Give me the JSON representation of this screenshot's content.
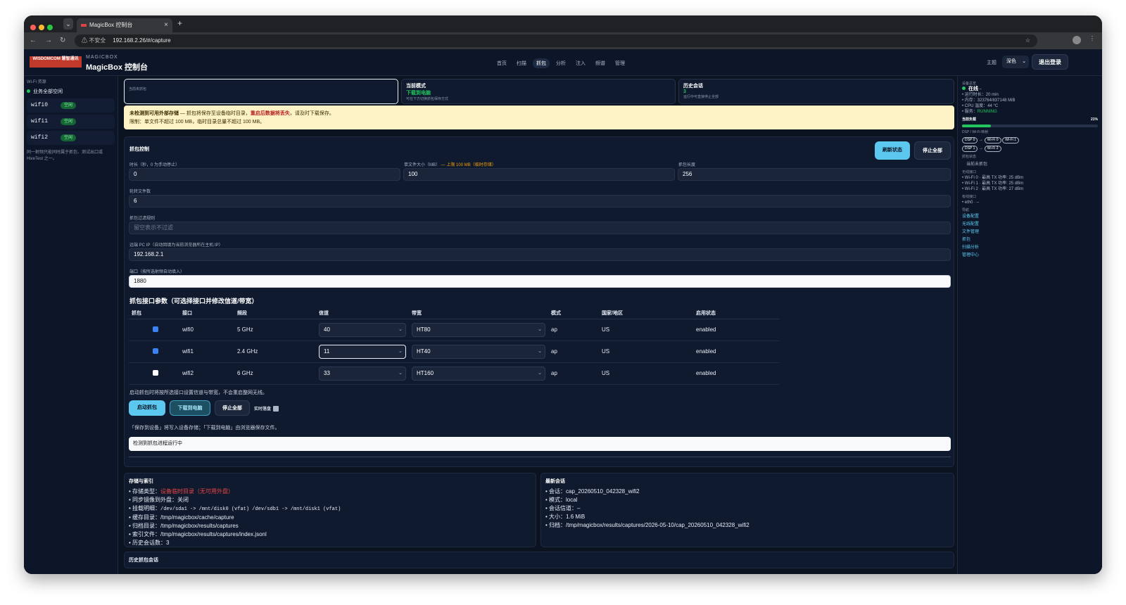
{
  "browser": {
    "tab_title": "MagicBox 控制台",
    "url": "192.168.2.26/#/capture",
    "security": "⚠ 不安全"
  },
  "topbar": {
    "logo_text": "WISDOMCOM 慧智通讯",
    "brand_small": "MAGICBOX",
    "brand_title": "MagicBox 控制台",
    "nav": [
      "首页",
      "扫描",
      "抓包",
      "分析",
      "注入",
      "频谱",
      "管理"
    ],
    "nav_active": "抓包",
    "theme_label": "主题",
    "theme_value": "深色",
    "logout_label": "退出登录"
  },
  "left": {
    "section_title": "Wi-Fi 资源",
    "status_line": "业务全部空闲",
    "items": [
      {
        "name": "wifi0",
        "badge": "空闲"
      },
      {
        "name": "wifi1",
        "badge": "空闲"
      },
      {
        "name": "wifi2",
        "badge": "空闲"
      }
    ],
    "note": "同一射频只能同时属于抓包、测试出口或 HiveTest 之一。"
  },
  "status_cards": {
    "c1_text": "当前未抓包",
    "c2_title": "当前模式",
    "c2_value": "下载到电脑",
    "c2_sub": "可在下方切换抓包保存方式",
    "c3_title": "历史会话",
    "c3_value": "3",
    "c3_sub": "运行中可直接停止全部"
  },
  "banner": {
    "bold_text": "未检测到可用外部存储",
    "text1": " — 抓包将保存至设备临时目录，",
    "red_text": "重启后数据将丢失",
    "text2": "，请及时下载保存。",
    "line2": "限制：单文件不超过 100 MB，临时目录总量不超过 100 MB。"
  },
  "capture": {
    "title": "抓包控制",
    "refresh_label": "刷新状态",
    "stop_all_label": "停止全部",
    "duration_label": "时长（秒，0 为手动停止）",
    "duration_value": "0",
    "filesize_label": "单文件大小（MB）",
    "filesize_hint": " — 上限 100 MB（临时存储）",
    "filesize_value": "100",
    "snaplen_label": "抓包长度",
    "snaplen_value": "256",
    "rotate_label": "轮转文件数",
    "rotate_value": "6",
    "filter_label": "抓包过滤规则",
    "filter_placeholder": "留空表示不过滤",
    "remote_ip_label": "远端 PC IP（自动回填为当前浏览器所在主机 IP）",
    "remote_ip_value": "192.168.2.1",
    "port_label": "端口（按所选射频自动填入）",
    "port_value": "1880",
    "iface_title": "抓包接口参数（可选择接口并修改信道/带宽）",
    "columns": [
      "抓包",
      "接口",
      "频段",
      "信道",
      "带宽",
      "模式",
      "国家/地区",
      "启用状态"
    ],
    "rows": [
      {
        "checked": true,
        "iface": "wifi0",
        "band": "5 GHz",
        "channel": "40",
        "bw": "HT80",
        "mode": "ap",
        "country": "US",
        "state": "enabled"
      },
      {
        "checked": true,
        "iface": "wifi1",
        "band": "2.4 GHz",
        "channel": "11",
        "bw": "HT40",
        "mode": "ap",
        "country": "US",
        "state": "enabled"
      },
      {
        "checked": false,
        "iface": "wifi2",
        "band": "6 GHz",
        "channel": "33",
        "bw": "HT160",
        "mode": "ap",
        "country": "US",
        "state": "enabled"
      }
    ],
    "apply_hint": "启动抓包时将按所选接口设置信道与带宽，不会重启整网无线。",
    "start_label": "启动抓包",
    "download_label": "下载到电脑",
    "stop_label": "停止全部",
    "realtime_label": "实时落盘",
    "save_hint": "「保存到设备」将写入设备存储；「下载到电脑」由浏览器保存文件。",
    "status_output": "检测到抓包进程运行中"
  },
  "storage": {
    "title": "存储与索引",
    "type_label": "存储类型：",
    "type_value": "设备临时目录（无可用外盘）",
    "sync": "同步镜像到外盘：关闭",
    "mount_label": "挂载明细：",
    "mount_value": "/dev/sda1 -> /mnt/disk0 (vfat) /dev/sdb1 -> /mnt/disk1 (vfat)",
    "cache": "缓存目录：/tmp/magicbox/cache/capture",
    "archive": "归档目录：/tmp/magicbox/results/captures",
    "index": "索引文件：/tmp/magicbox/results/captures/index.jsonl",
    "history_count": "历史会话数：3"
  },
  "latest": {
    "title": "最新会话",
    "session": "会话：cap_20260510_042328_wifi2",
    "mode": "模式：local",
    "channel": "会话信道：–",
    "size": "大小：1.6 MiB",
    "archive": "归档：/tmp/magicbox/results/captures/2026-05-10/cap_20260510_042328_wifi2"
  },
  "history": {
    "title": "历史抓包会话"
  },
  "right": {
    "device_title": "设备总览",
    "online": "在线",
    "online_suffix": " –",
    "uptime": "运行时长：20 min",
    "memory": "内存：323764/837148 MiB",
    "cpu_temp": "CPU 温度：44 °C",
    "service_label": "服务：",
    "service_value": "RUNNING",
    "load_label": "当前负载",
    "load_value": "21%",
    "load_fraction": 0.21,
    "dsp_title": "DSP / Wi-Fi 映射",
    "dsp0": "DSP 0",
    "dsp0_targets": [
      "Wi-Fi 0",
      "Wi-Fi 1"
    ],
    "dsp1": "DSP 1",
    "dsp1_targets": [
      "Wi-Fi 2"
    ],
    "capture_state_title": "抓包状态",
    "capture_state": "当前未抓包",
    "wireless_title": "无线接口",
    "wireless": [
      "Wi-Fi 0 · 最高 TX 功率: 25 dBm",
      "Wi-Fi 1 · 最高 TX 功率: 25 dBm",
      "Wi-Fi 2 · 最高 TX 功率: 27 dBm"
    ],
    "wired_title": "有线接口",
    "wired": "eth0 · –",
    "nav_title": "导航",
    "links": [
      "设备配置",
      "无线配置",
      "文件管理",
      "抓包",
      "扫描分析",
      "管理中心"
    ]
  },
  "colors": {
    "accent": "#5cc8f0",
    "success": "#22c55e",
    "danger": "#ef4444",
    "warning_bg": "#fdf3c7",
    "bg": "#0b1220"
  }
}
